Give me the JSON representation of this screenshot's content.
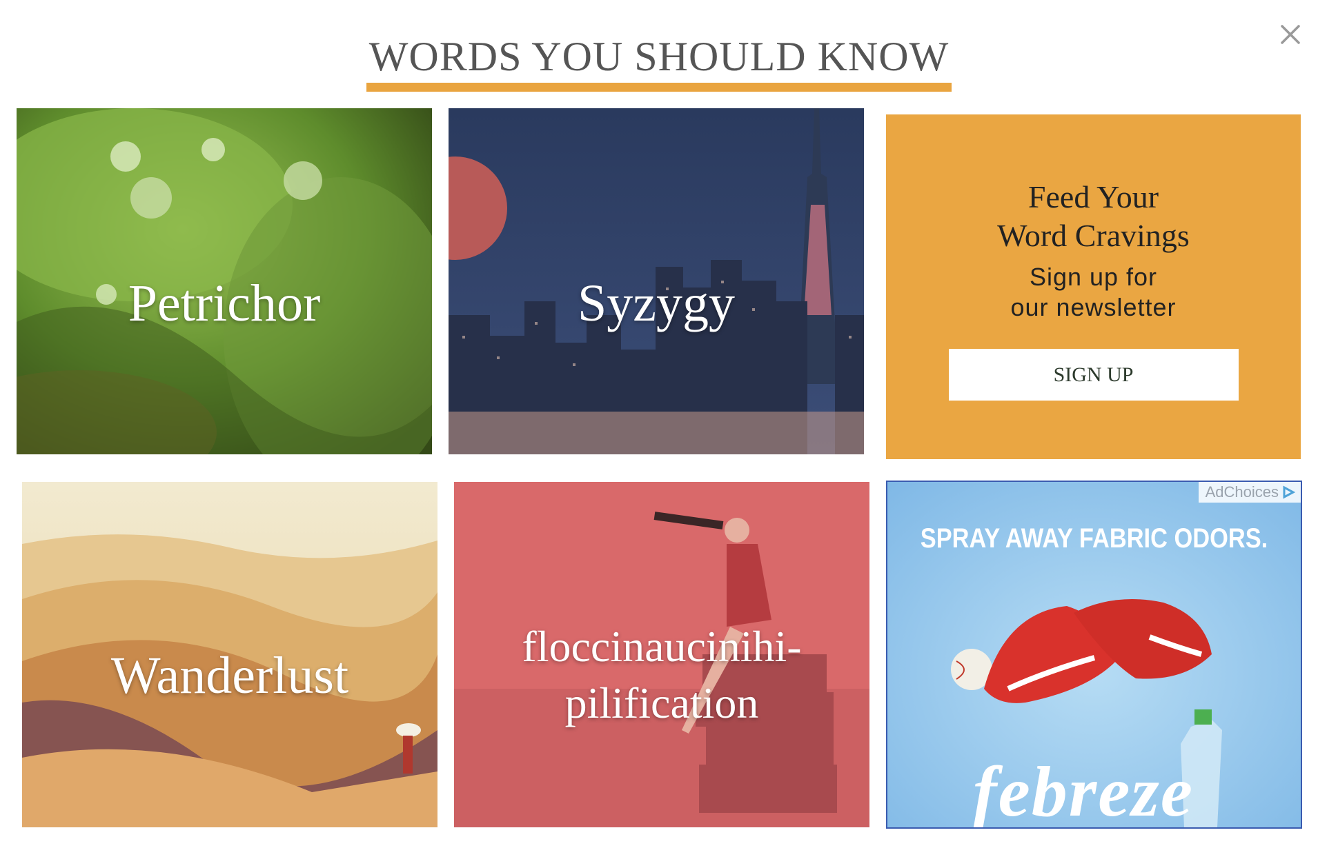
{
  "header": {
    "title": "WORDS YOU SHOULD KNOW"
  },
  "close": {
    "symbol": "×"
  },
  "tiles": [
    {
      "word": "Petrichor"
    },
    {
      "word": "Syzygy"
    },
    {
      "word": "Wanderlust"
    },
    {
      "word_line1": "floccinaucinihi-",
      "word_line2": "pilification"
    }
  ],
  "promo": {
    "heading_line1": "Feed Your",
    "heading_line2": "Word Cravings",
    "sub_line1": "Sign up for",
    "sub_line2": "our newsletter",
    "button": "SIGN UP"
  },
  "ad": {
    "adchoices": "AdChoices",
    "headline": "SPRAY AWAY FABRIC ODORS.",
    "brand": "febreze"
  },
  "colors": {
    "accent": "#e9a43f",
    "promo_bg": "#eaa642",
    "ad_bg": "#8ec4ea"
  }
}
